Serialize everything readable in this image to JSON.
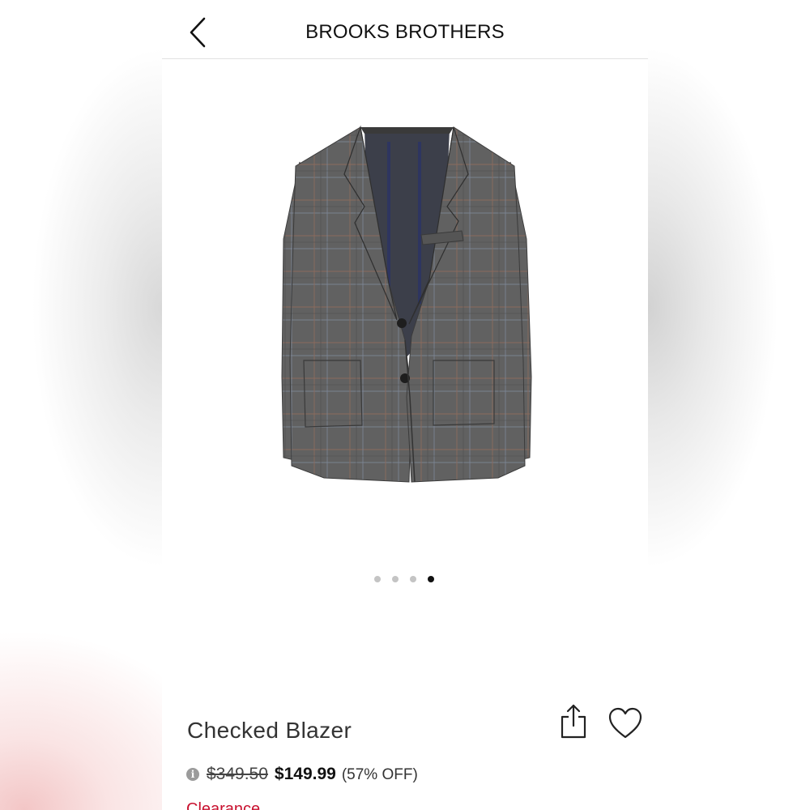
{
  "header": {
    "brand": "BROOKS BROTHERS",
    "back_icon": "chevron-left-icon"
  },
  "gallery": {
    "image_subject": "grey checked blazer",
    "slide_count": 4,
    "active_slide": 4
  },
  "product": {
    "name": "Checked Blazer",
    "original_price": "$349.50",
    "sale_price": "$149.99",
    "discount": "(57% OFF)",
    "badge": "Clearance",
    "info_icon_glyph": "i"
  },
  "actions": {
    "share_icon": "share-icon",
    "favorite_icon": "heart-icon"
  },
  "colors": {
    "clearance": "#c8102e",
    "active_dot": "#111111",
    "inactive_dot": "#c4c4c4"
  }
}
